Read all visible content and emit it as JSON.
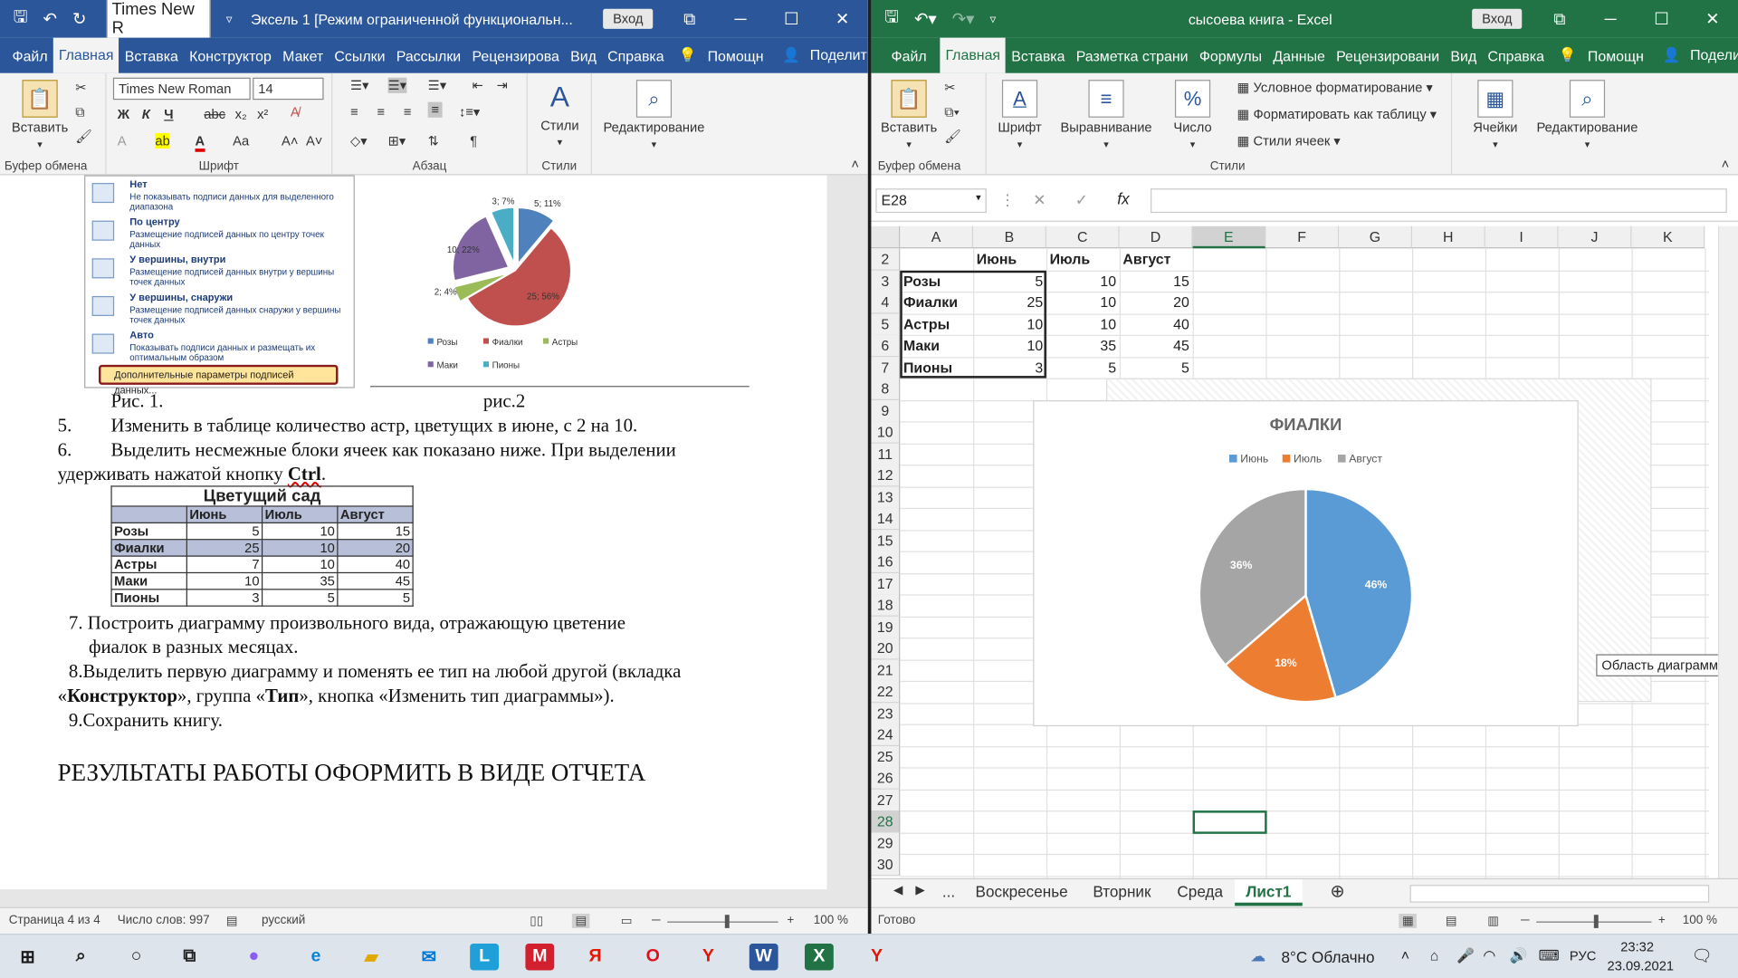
{
  "word": {
    "title": "Эксель 1 [Режим ограниченной функциональн...",
    "login": "Вход",
    "font_name_qa": "Times New R",
    "tabs": [
      "Файл",
      "Главная",
      "Вставка",
      "Конструктор",
      "Макет",
      "Ссылки",
      "Рассылки",
      "Рецензирова",
      "Вид",
      "Справка"
    ],
    "help": "Помощн",
    "share": "Поделиться",
    "ribbon": {
      "paste": "Вставить",
      "font_name": "Times New Roman",
      "font_size": "14",
      "styles": "Стили",
      "editing": "Редактирование",
      "group_clipboard": "Буфер обмена",
      "group_font": "Шрифт",
      "group_paragraph": "Абзац",
      "group_styles": "Стили"
    },
    "menu": [
      {
        "title": "Нет",
        "desc": "Не показывать подписи данных для выделенного диапазона"
      },
      {
        "title": "По центру",
        "desc": "Размещение подписей данных по центру точек данных"
      },
      {
        "title": "У вершины, внутри",
        "desc": "Размещение подписей данных внутри у вершины точек данных"
      },
      {
        "title": "У вершины, снаружи",
        "desc": "Размещение подписей данных снаружи у вершины точек данных"
      },
      {
        "title": "Авто",
        "desc": "Показывать подписи данных и размещать их оптимальным образом"
      }
    ],
    "menu_more": "Дополнительные параметры подписей данных...",
    "fig1": "Рис. 1.",
    "fig2": "рис.2",
    "pie2_labels": [
      "3; 7%",
      "5; 11%",
      "10; 22%",
      "2; 4%",
      "25; 56%"
    ],
    "pie2_legend": [
      "Розы",
      "Фиалки",
      "Астры",
      "Маки",
      "Пионы"
    ],
    "item5_num": "5.",
    "item5": "Изменить в таблице количество астр, цветущих в июне, с 2 на 10.",
    "item6_num": "6.",
    "item6_line1": "Выделить несмежные блоки ячеек как показано ниже. При выделении",
    "item6_line2": "удерживать нажатой кнопку ",
    "item6_ctrl": "Ctrl",
    "item6_end": ".",
    "garden_caption": "Цветущий сад",
    "garden_headers": [
      "",
      "Июнь",
      "Июль",
      "Август"
    ],
    "garden_rows": [
      [
        "Розы",
        "5",
        "10",
        "15"
      ],
      [
        "Фиалки",
        "25",
        "10",
        "20"
      ],
      [
        "Астры",
        "7",
        "10",
        "40"
      ],
      [
        "Маки",
        "10",
        "35",
        "45"
      ],
      [
        "Пионы",
        "3",
        "5",
        "5"
      ]
    ],
    "item7_line1": "7. Построить    диаграмму    произвольного    вида,    отражающую    цветение",
    "item7_line2": "фиалок в разных месяцах.",
    "item8_a": "8.Выделить первую диаграмму и поменять ее тип на любой другой (вкладка",
    "item8_b1": "«",
    "item8_b2": "Конструктор",
    "item8_b3": "», группа «",
    "item8_b4": "Тип",
    "item8_b5": "», кнопка «Изменить тип диаграммы»).",
    "item9": "9.Сохранить книгу.",
    "result": "РЕЗУЛЬТАТЫ РАБОТЫ ОФОРМИТЬ В ВИДЕ ОТЧЕТА",
    "status": {
      "page": "Страница 4 из 4",
      "words": "Число слов: 997",
      "lang": "русский",
      "zoom": "100 %"
    }
  },
  "excel": {
    "title": "сысоева книга  -  Excel",
    "login": "Вход",
    "tabs": [
      "Файл",
      "Главная",
      "Вставка",
      "Разметка страни",
      "Формулы",
      "Данные",
      "Рецензировани",
      "Вид",
      "Справка"
    ],
    "help": "Помощн",
    "share": "Поделиться",
    "ribbon": {
      "paste": "Вставить",
      "font": "Шрифт",
      "align": "Выравнивание",
      "number": "Число",
      "cond_format": "Условное форматирование",
      "format_table": "Форматировать как таблицу",
      "cell_styles": "Стили ячеек",
      "cells": "Ячейки",
      "editing": "Редактирование",
      "group_clipboard": "Буфер обмена",
      "group_styles": "Стили"
    },
    "namebox": "E28",
    "fx": "fx",
    "columns": [
      "A",
      "B",
      "C",
      "D",
      "E",
      "F",
      "G",
      "H",
      "I",
      "J",
      "K"
    ],
    "rows": [
      "2",
      "3",
      "4",
      "5",
      "6",
      "7",
      "8",
      "9",
      "10",
      "11",
      "12",
      "13",
      "14",
      "15",
      "16",
      "17",
      "18",
      "19",
      "20",
      "21",
      "22",
      "23",
      "24",
      "25",
      "26",
      "27",
      "28",
      "29",
      "30"
    ],
    "headers": [
      "Июнь",
      "Июль",
      "Август"
    ],
    "table": [
      [
        "Розы",
        "5",
        "10",
        "15"
      ],
      [
        "Фиалки",
        "25",
        "10",
        "20"
      ],
      [
        "Астры",
        "10",
        "10",
        "40"
      ],
      [
        "Маки",
        "10",
        "35",
        "45"
      ],
      [
        "Пионы",
        "3",
        "5",
        "5"
      ]
    ],
    "tooltip": "Область диаграммы",
    "sheets": [
      "...",
      "Воскресенье",
      "Вторник",
      "Среда",
      "Лист1"
    ],
    "status": {
      "ready": "Готово",
      "zoom": "100 %"
    }
  },
  "chart_data": [
    {
      "type": "pie",
      "title": "ФИАЛКИ",
      "categories": [
        "Июнь",
        "Июль",
        "Август"
      ],
      "values": [
        25,
        10,
        20
      ],
      "labels": [
        "46%",
        "18%",
        "36%"
      ],
      "colors": [
        "#5b9bd5",
        "#ed7d31",
        "#a5a5a5"
      ],
      "legend": "top"
    },
    {
      "type": "pie",
      "title": "",
      "categories": [
        "Розы",
        "Фиалки",
        "Астры",
        "Маки",
        "Пионы"
      ],
      "values": [
        5,
        25,
        2,
        10,
        3
      ],
      "labels": [
        "5; 11%",
        "25; 56%",
        "2; 4%",
        "10; 22%",
        "3; 7%"
      ],
      "colors": [
        "#4f81bd",
        "#c0504d",
        "#9bbb59",
        "#8064a2",
        "#4bacc6"
      ],
      "legend": "bottom"
    }
  ],
  "taskbar": {
    "weather": "8°C  Облачно",
    "lang": "РУС",
    "time": "23:32",
    "date": "23.09.2021"
  }
}
